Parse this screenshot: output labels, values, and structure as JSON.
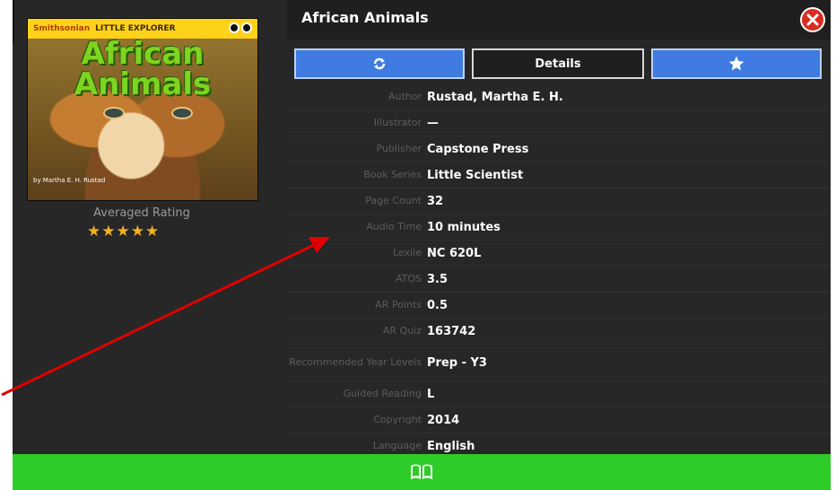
{
  "modal": {
    "title": "African Animals",
    "close_icon": "close-circle-icon"
  },
  "cover": {
    "brand": "Smithsonian",
    "series_brand": "LITTLE EXPLORER",
    "title": "African Animals",
    "author_line": "by Martha E. H. Rustad"
  },
  "rating": {
    "label": "Averaged Rating",
    "stars": 5,
    "max": 5
  },
  "buttons": {
    "refresh_icon": "refresh-icon",
    "details_label": "Details",
    "favorite_icon": "star-icon",
    "read_icon": "open-book-icon"
  },
  "details": [
    {
      "label": "Author",
      "value": "Rustad, Martha E. H."
    },
    {
      "label": "Illustrator",
      "value": "—"
    },
    {
      "label": "Publisher",
      "value": "Capstone Press"
    },
    {
      "label": "Book Series",
      "value": "Little Scientist"
    },
    {
      "label": "Page Count",
      "value": "32"
    },
    {
      "label": "Audio Time",
      "value": "10 minutes"
    },
    {
      "label": "Lexile",
      "value": "NC 620L"
    },
    {
      "label": "ATOS",
      "value": "3.5"
    },
    {
      "label": "AR Points",
      "value": "0.5"
    },
    {
      "label": "AR Quiz",
      "value": "163742"
    },
    {
      "label": "Recommended Year Levels",
      "value": "Prep - Y3"
    },
    {
      "label": "Guided Reading",
      "value": "L"
    },
    {
      "label": "Copyright",
      "value": "2014"
    },
    {
      "label": "Language",
      "value": "English"
    }
  ],
  "colors": {
    "primary_blue": "#3f7be0",
    "read_green": "#2ecc29",
    "close_red": "#d92d20",
    "star_gold": "#f3b020",
    "annotation_arrow": "#e00000"
  }
}
